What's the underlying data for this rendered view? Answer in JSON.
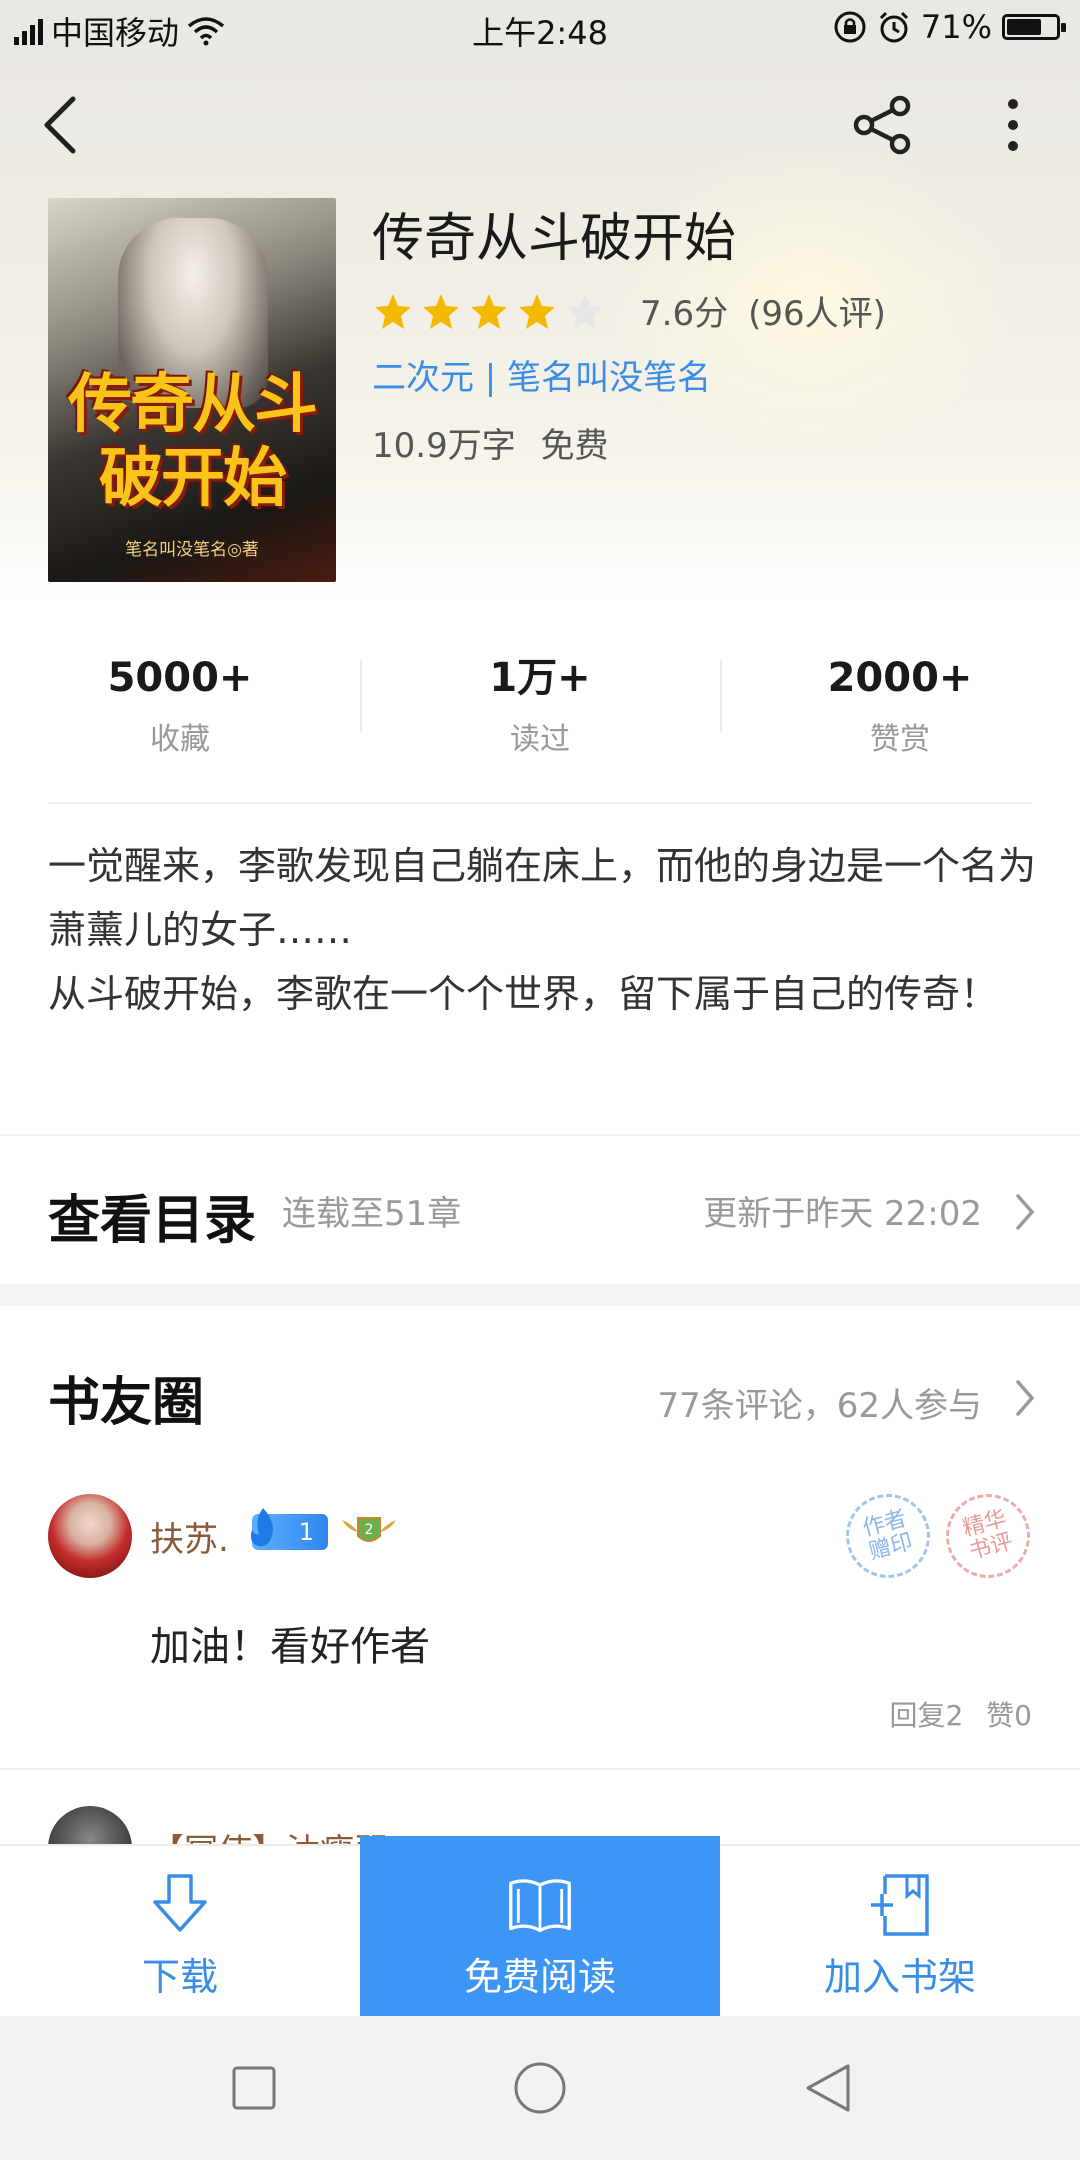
{
  "status_bar": {
    "carrier": "中国移动",
    "time": "上午2:48",
    "battery_percent": "71%",
    "battery_level": 0.71
  },
  "nav": {
    "back_icon": "back-arrow-icon",
    "share_icon": "share-icon",
    "more_icon": "more-vertical-icon"
  },
  "book": {
    "cover_title": "传奇从斗破开始",
    "cover_author": "笔名叫没笔名◎著",
    "title": "传奇从斗破开始",
    "rating_stars": 4,
    "rating_max": 5,
    "score": "7.6分",
    "raters": "(96人评)",
    "tags": "二次元 | 笔名叫没笔名",
    "words": "10.9万字",
    "price": "免费"
  },
  "stats": [
    {
      "value": "5000+",
      "label": "收藏"
    },
    {
      "value": "1万+",
      "label": "读过"
    },
    {
      "value": "2000+",
      "label": "赞赏"
    }
  ],
  "synopsis": {
    "line1": "一觉醒来，李歌发现自己躺在床上，而他的身边是一个名为萧薰儿的女子……",
    "line2": "从斗破开始，李歌在一个个世界，留下属于自己的传奇！"
  },
  "catalog": {
    "title": "查看目录",
    "serial": "连载至51章",
    "updated": "更新于昨天 22:02"
  },
  "circle": {
    "title": "书友圈",
    "summary": "77条评论，62人参与"
  },
  "comments": [
    {
      "username": "扶苏.",
      "level": "1",
      "medal": "2",
      "stamp_left": "作者\n赠印",
      "stamp_right": "精华\n书评",
      "text": "加油！看好作者",
      "replies": "回复2",
      "likes": "赞0"
    },
    {
      "username": "【冥使】沐瘦弱"
    }
  ],
  "bottom_bar": {
    "download": "下载",
    "read": "免费阅读",
    "add_shelf": "加入书架"
  },
  "colors": {
    "accent": "#3d96f5",
    "link": "#3a8de6",
    "star": "#f5b800"
  }
}
